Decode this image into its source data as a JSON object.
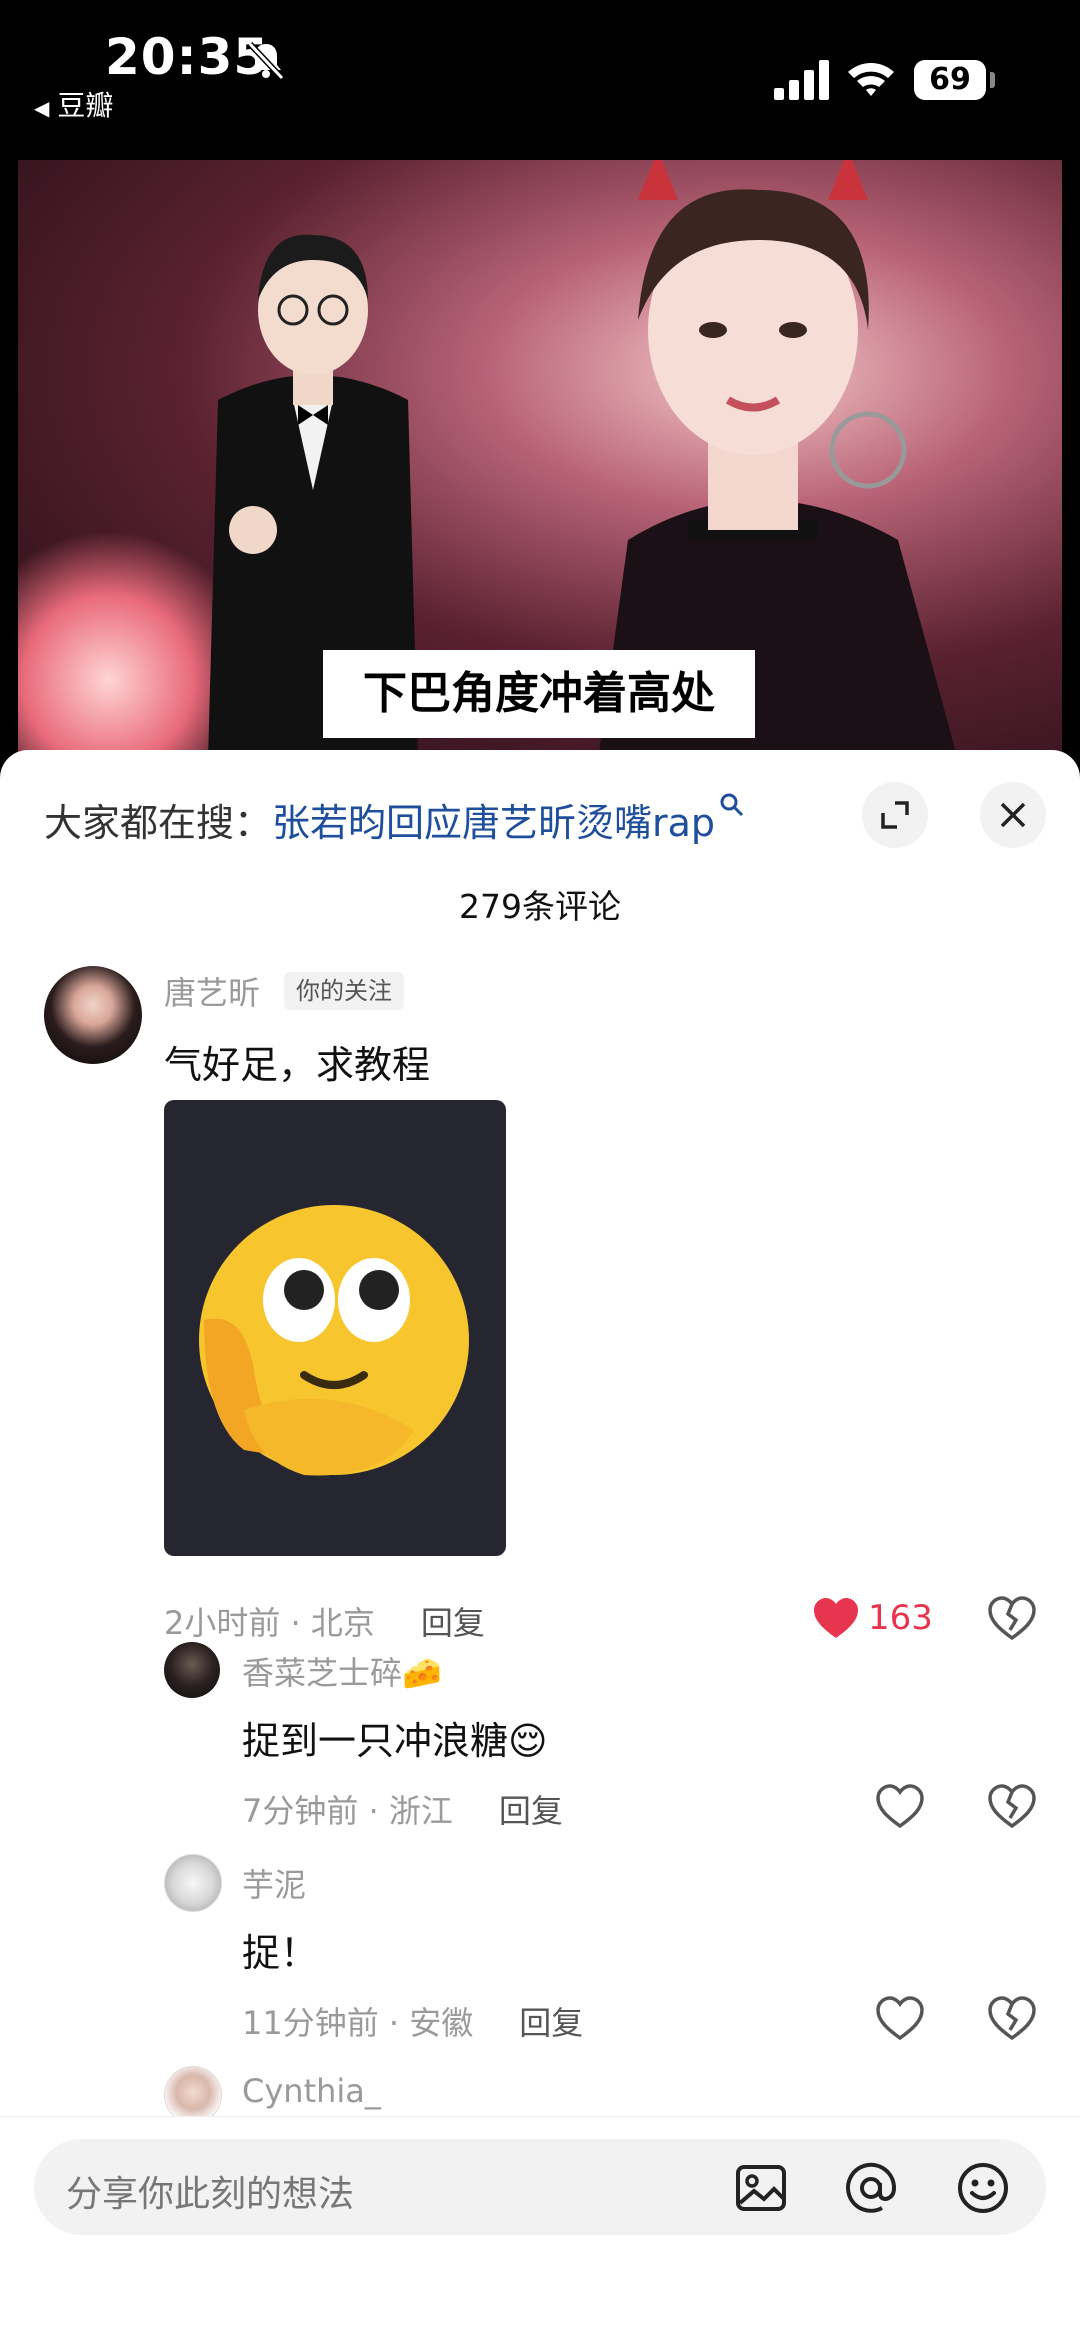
{
  "status_bar": {
    "time": "20:35",
    "back_app": "豆瓣",
    "battery": "69"
  },
  "video": {
    "subtitle": "下巴角度冲着高处"
  },
  "sheet": {
    "search_prefix": "大家都在搜：",
    "search_link": "张若昀回应唐艺昕烫嘴rap",
    "comment_count": "279条评论"
  },
  "comments": [
    {
      "user": "唐艺昕",
      "badge": "你的关注",
      "text": "气好足，求教程",
      "time_location": "2小时前 · 北京",
      "reply_label": "回复",
      "likes": "163"
    }
  ],
  "replies": [
    {
      "user": "香菜芝士碎🧀",
      "text": "捉到一只冲浪糖😌",
      "time_location": "7分钟前 · 浙江",
      "reply_label": "回复"
    },
    {
      "user": "芋泥",
      "text": "捉！",
      "time_location": "11分钟前 · 安徽",
      "reply_label": "回复"
    },
    {
      "user": "Cynthia_"
    }
  ],
  "input": {
    "placeholder": "分享你此刻的想法"
  },
  "colors": {
    "link": "#1f4f9c",
    "like": "#e8354f",
    "meta": "#9a9a9a"
  }
}
